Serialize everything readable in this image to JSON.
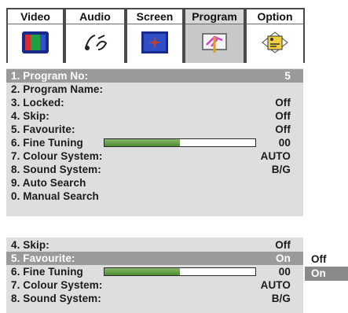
{
  "tabs": [
    {
      "label": "Video",
      "icon": "tv-color-bars-icon",
      "active": false
    },
    {
      "label": "Audio",
      "icon": "music-note-icon",
      "active": false
    },
    {
      "label": "Screen",
      "icon": "screen-icon",
      "active": false
    },
    {
      "label": "Program",
      "icon": "antenna-icon",
      "active": true
    },
    {
      "label": "Option",
      "icon": "option-icon",
      "active": false
    }
  ],
  "menu1": {
    "rows": [
      {
        "label": "1. Program No:",
        "value": "5",
        "highlighted": true
      },
      {
        "label": "2. Program Name:",
        "value": ""
      },
      {
        "label": "3. Locked:",
        "value": "Off"
      },
      {
        "label": "4. Skip:",
        "value": "Off"
      },
      {
        "label": "5. Favourite:",
        "value": "Off"
      },
      {
        "label": "6. Fine Tuning",
        "value": "00",
        "bar_level": 0.5
      },
      {
        "label": "7. Colour System:",
        "value": "AUTO"
      },
      {
        "label": "8. Sound System:",
        "value": "B/G"
      },
      {
        "label": "9. Auto Search",
        "value": ""
      },
      {
        "label": "0. Manual Search",
        "value": ""
      }
    ]
  },
  "menu2": {
    "rows": [
      {
        "label": "4. Skip:",
        "value": "Off"
      },
      {
        "label": "5. Favourite:",
        "value": "On",
        "highlighted": true
      },
      {
        "label": "6. Fine Tuning",
        "value": "00",
        "bar_level": 0.5
      },
      {
        "label": "7. Colour System:",
        "value": "AUTO"
      },
      {
        "label": "8. Sound System:",
        "value": "B/G"
      }
    ]
  },
  "dropdown": {
    "options": [
      "Off",
      "On"
    ],
    "selected": "On"
  },
  "colors": {
    "highlight": "#9a9a9a",
    "panel_bg": "#dedede",
    "bar_fill": "#5c9a3e"
  }
}
